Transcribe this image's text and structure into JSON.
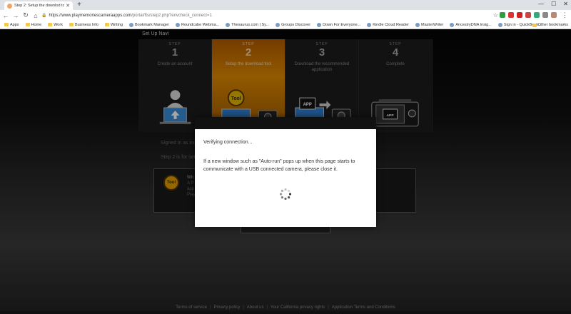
{
  "browser": {
    "tab_title": "Step 2: Setup the downlod tool",
    "url_main": "https://www.playmemoriescameraapps.com",
    "url_path": "/portal/fts/step2.php?envcheck_connect=1",
    "bookmarks": [
      "Apps",
      "Home",
      "Work",
      "Business Info",
      "Writing",
      "Bookmark Manager",
      "Roundcube Webma...",
      "Thesaurus.com | Sy...",
      "Groups Discover",
      "Down For Everyone...",
      "Kindle Cloud Reader",
      "MasterWriter",
      "AncestryDNA Insig...",
      "Sign in - QuickBook..."
    ],
    "other_bookmarks": "Other bookmarks"
  },
  "page": {
    "setup_title": "Set Up Navi",
    "steps": [
      {
        "word": "STEP",
        "num": "1",
        "desc": "Create an account"
      },
      {
        "word": "STEP",
        "num": "2",
        "desc": "Setup the download tool"
      },
      {
        "word": "STEP",
        "num": "3",
        "desc": "Download the recommended application"
      },
      {
        "word": "STEP",
        "num": "4",
        "desc": "Complete"
      }
    ],
    "bg_signed": "Signed in as ino",
    "bg_step2": "Step 2 is for set",
    "tool_badge": "Tool",
    "tool_heading": "Wh",
    "tool_line1": "A P",
    "tool_line2": "app",
    "tool_line3": "PlayI",
    "footer": [
      "Terms of service",
      "Privacy policy",
      "About us",
      "Your California privacy rights",
      "Application Terms and Conditions"
    ]
  },
  "modal": {
    "line1": "Verifying connection...",
    "line2": "If a new window such as \"Auto-run\" pops up when this page starts to communicate with a USB connected camera, please close it."
  },
  "colors": {
    "accent": "#e08a00",
    "page_bg": "#101010"
  }
}
